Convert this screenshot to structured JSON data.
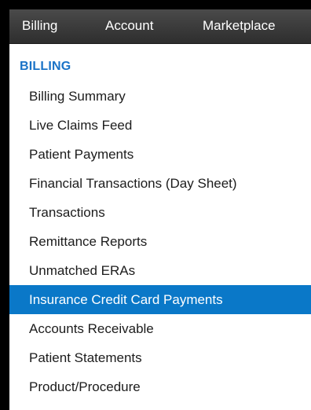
{
  "top_nav": {
    "tabs": [
      {
        "label": "Billing"
      },
      {
        "label": "Account"
      },
      {
        "label": "Marketplace"
      }
    ]
  },
  "menu": {
    "section_title": "BILLING",
    "active_index": 7,
    "items": [
      {
        "label": "Billing Summary"
      },
      {
        "label": "Live Claims Feed"
      },
      {
        "label": "Patient Payments"
      },
      {
        "label": "Financial Transactions (Day Sheet)"
      },
      {
        "label": "Transactions"
      },
      {
        "label": "Remittance Reports"
      },
      {
        "label": "Unmatched ERAs"
      },
      {
        "label": "Insurance Credit Card Payments"
      },
      {
        "label": "Accounts Receivable"
      },
      {
        "label": "Patient Statements"
      },
      {
        "label": "Product/Procedure"
      }
    ]
  },
  "colors": {
    "accent": "#0a78c8",
    "section_title": "#1a73c7",
    "nav_background": "#3a3a3a"
  }
}
